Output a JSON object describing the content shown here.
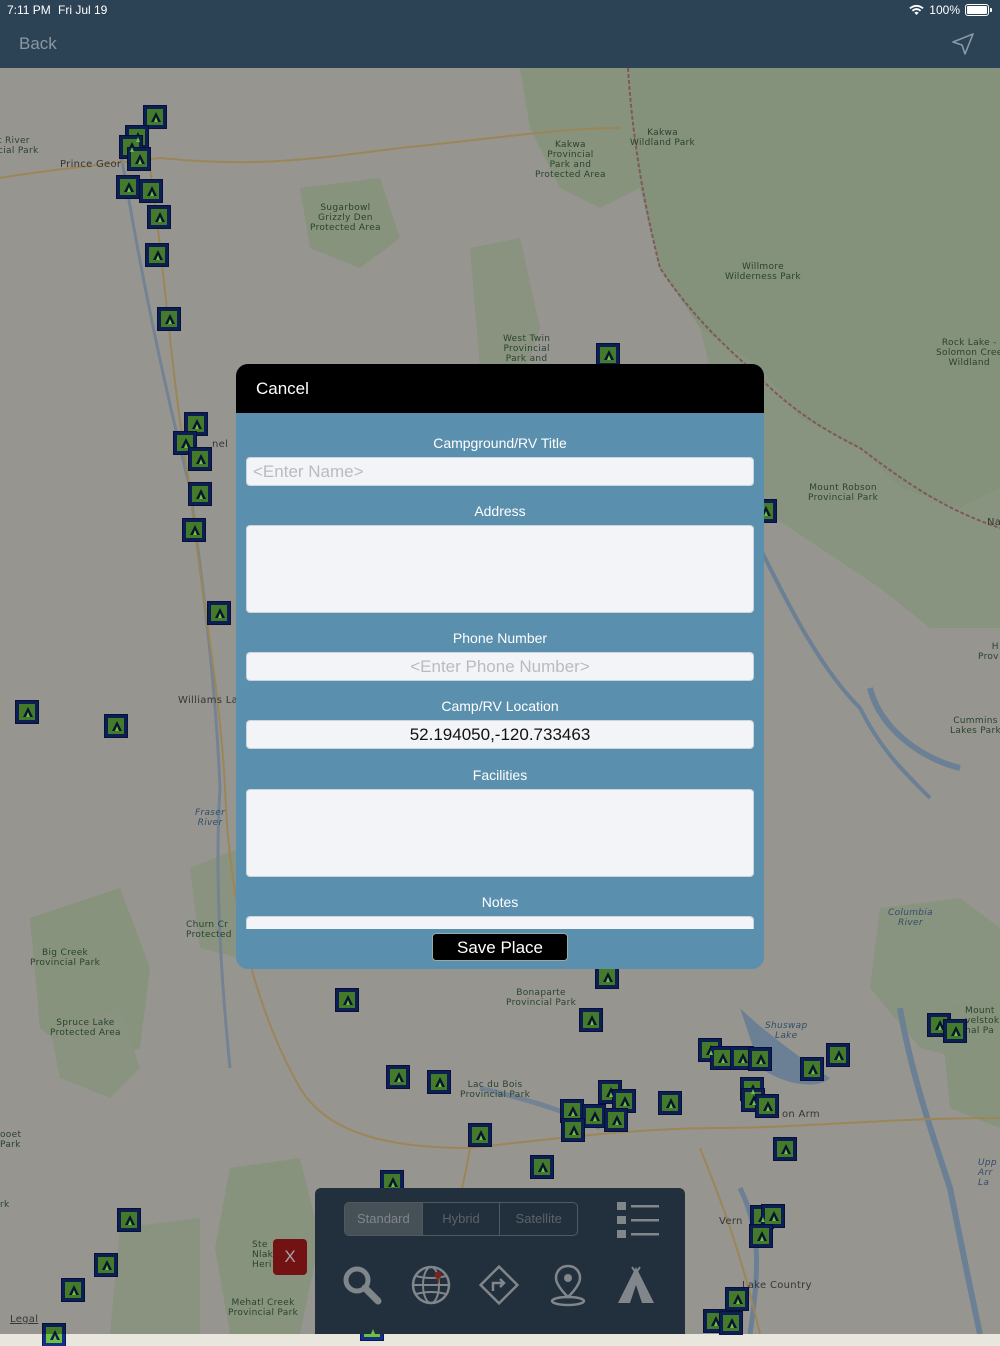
{
  "status": {
    "time": "7:11 PM",
    "date": "Fri Jul 19",
    "battery": "100%"
  },
  "nav": {
    "back_label": "Back",
    "locate_icon": "location-arrow-icon"
  },
  "map": {
    "labels": [
      {
        "text": "t River\ncial Park",
        "cls": ""
      },
      {
        "text": "Prince Geor",
        "cls": "town"
      },
      {
        "text": "Sugarbowl\nGrizzly Den\nProtected Area",
        "cls": ""
      },
      {
        "text": "Kakwa\nProvincial\nPark and\nProtected Area",
        "cls": ""
      },
      {
        "text": "Kakwa\nWildland Park",
        "cls": ""
      },
      {
        "text": "Willmore\nWilderness Park",
        "cls": ""
      },
      {
        "text": "West Twin\nProvincial\nPark and",
        "cls": ""
      },
      {
        "text": "Rock Lake -\nSolomon Cree\nWildland",
        "cls": ""
      },
      {
        "text": "nel",
        "cls": "town"
      },
      {
        "text": "Mount Robson\nProvincial Park",
        "cls": ""
      },
      {
        "text": "Na",
        "cls": "town"
      },
      {
        "text": "H\nProv",
        "cls": ""
      },
      {
        "text": "Williams La",
        "cls": "town"
      },
      {
        "text": "Cummins\nLakes Park",
        "cls": ""
      },
      {
        "text": "Fraser\nRiver",
        "cls": "water"
      },
      {
        "text": "Churn Cr\nProtected",
        "cls": ""
      },
      {
        "text": "Big Creek\nProvincial Park",
        "cls": ""
      },
      {
        "text": "Columbia\nRiver",
        "cls": "water"
      },
      {
        "text": "Bonaparte\nProvincial Park",
        "cls": ""
      },
      {
        "text": "Spruce Lake\nProtected Area",
        "cls": ""
      },
      {
        "text": "Shuswap\nLake",
        "cls": "water"
      },
      {
        "text": "Mount\nvelstok\nnal Pa",
        "cls": ""
      },
      {
        "text": "Lac du Bois\nProvincial Park",
        "cls": ""
      },
      {
        "text": "ooet\nPark",
        "cls": ""
      },
      {
        "text": "on Arm",
        "cls": "town"
      },
      {
        "text": "Upp\nArr\nLa",
        "cls": "water"
      },
      {
        "text": "rk",
        "cls": ""
      },
      {
        "text": "Vern",
        "cls": "town"
      },
      {
        "text": "Ste\nNlak\nHeri",
        "cls": ""
      },
      {
        "text": "Lake Country",
        "cls": "town"
      },
      {
        "text": "Mehatl Creek\nProvincial Park",
        "cls": ""
      },
      {
        "text": "Legal",
        "cls": "town"
      }
    ]
  },
  "modal": {
    "cancel_label": "Cancel",
    "title_label": "Campground/RV Title",
    "title_placeholder": "<Enter Name>",
    "title_value": "",
    "address_label": "Address",
    "address_value": "",
    "phone_label": "Phone Number",
    "phone_placeholder": "<Enter Phone Number>",
    "phone_value": "",
    "location_label": "Camp/RV Location",
    "location_value": "52.194050,-120.733463",
    "facilities_label": "Facilities",
    "facilities_value": "",
    "notes_label": "Notes",
    "notes_value": "",
    "save_label": "Save Place"
  },
  "marker": {
    "close_label": "X"
  },
  "toolbar": {
    "map_types": [
      {
        "label": "Standard",
        "selected": true
      },
      {
        "label": "Hybrid",
        "selected": false
      },
      {
        "label": "Satellite",
        "selected": false
      }
    ],
    "tools": [
      "search-icon",
      "globe-icon",
      "directions-icon",
      "map-pin-icon",
      "tent-icon",
      "list-icon"
    ]
  },
  "colors": {
    "nav_bg": "#2c4355",
    "modal_bg": "#5b8fae",
    "camp_fill": "#6ac142",
    "camp_border": "#152f86",
    "toolbar_bg": "#344b5e",
    "close_red": "#b51d1d"
  }
}
